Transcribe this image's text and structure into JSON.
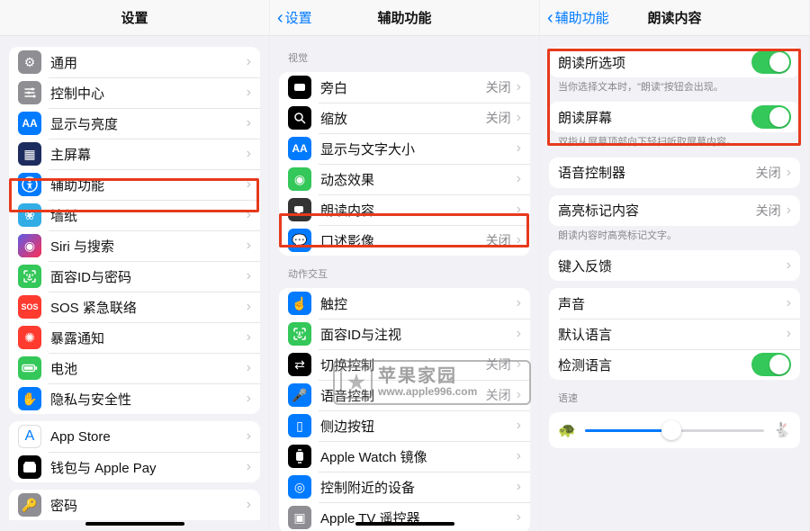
{
  "panel1": {
    "title": "设置",
    "groups": [
      {
        "rows": [
          {
            "icon": "gear",
            "bg": "bg-gray",
            "label": "通用"
          },
          {
            "icon": "sliders",
            "bg": "bg-gray",
            "label": "控制中心"
          },
          {
            "icon": "AA",
            "bg": "bg-blue",
            "label": "显示与亮度"
          },
          {
            "icon": "grid",
            "bg": "bg-darkblue",
            "label": "主屏幕"
          },
          {
            "icon": "access",
            "bg": "bg-blue",
            "label": "辅助功能"
          },
          {
            "icon": "flower",
            "bg": "bg-cyan",
            "label": "墙纸"
          },
          {
            "icon": "siri",
            "bg": "bg-black",
            "label": "Siri 与搜索"
          },
          {
            "icon": "faceid",
            "bg": "bg-green",
            "label": "面容ID与密码"
          },
          {
            "icon": "SOS",
            "bg": "bg-red",
            "label": "SOS 紧急联络"
          },
          {
            "icon": "virus",
            "bg": "bg-red",
            "label": "暴露通知"
          },
          {
            "icon": "battery",
            "bg": "bg-green",
            "label": "电池"
          },
          {
            "icon": "hand",
            "bg": "bg-blue",
            "label": "隐私与安全性"
          }
        ]
      },
      {
        "rows": [
          {
            "icon": "A",
            "bg": "bg-white",
            "label": "App Store"
          },
          {
            "icon": "wallet",
            "bg": "bg-black",
            "label": "钱包与 Apple Pay"
          }
        ]
      },
      {
        "rows": [
          {
            "icon": "key",
            "bg": "bg-gray",
            "label": "密码"
          }
        ]
      }
    ]
  },
  "panel2": {
    "back": "设置",
    "title": "辅助功能",
    "section1_header": "视觉",
    "section1_rows": [
      {
        "icon": "vo",
        "bg": "bg-black",
        "label": "旁白",
        "value": "关闭"
      },
      {
        "icon": "zoom",
        "bg": "bg-black",
        "label": "缩放",
        "value": "关闭"
      },
      {
        "icon": "AA",
        "bg": "bg-blue",
        "label": "显示与文字大小"
      },
      {
        "icon": "motion",
        "bg": "bg-green",
        "label": "动态效果"
      },
      {
        "icon": "speak",
        "bg": "bg-dark",
        "label": "朗读内容"
      },
      {
        "icon": "chat",
        "bg": "bg-blue",
        "label": "口述影像",
        "value": "关闭"
      }
    ],
    "section2_header": "动作交互",
    "section2_rows": [
      {
        "icon": "touch",
        "bg": "bg-blue",
        "label": "触控"
      },
      {
        "icon": "faceid",
        "bg": "bg-green",
        "label": "面容ID与注视"
      },
      {
        "icon": "switch",
        "bg": "bg-black",
        "label": "切换控制",
        "value": "关闭"
      },
      {
        "icon": "voice",
        "bg": "bg-blue",
        "label": "语音控制",
        "value": "关闭"
      },
      {
        "icon": "side",
        "bg": "bg-blue",
        "label": "侧边按钮"
      },
      {
        "icon": "watch",
        "bg": "bg-black",
        "label": "Apple Watch 镜像"
      },
      {
        "icon": "near",
        "bg": "bg-blue",
        "label": "控制附近的设备"
      },
      {
        "icon": "tv",
        "bg": "bg-gray",
        "label": "Apple TV 遥控器"
      }
    ]
  },
  "panel3": {
    "back": "辅助功能",
    "title": "朗读内容",
    "g1": {
      "rows": [
        {
          "label": "朗读所选项",
          "toggle": true
        }
      ],
      "footnote": "当你选择文本时，\"朗读\"按钮会出现。"
    },
    "g2": {
      "rows": [
        {
          "label": "朗读屏幕",
          "toggle": true
        }
      ],
      "footnote": "双指从屏幕顶部向下轻扫听取屏幕内容。"
    },
    "g3": {
      "rows": [
        {
          "label": "语音控制器",
          "value": "关闭"
        }
      ]
    },
    "g4": {
      "rows": [
        {
          "label": "高亮标记内容",
          "value": "关闭"
        }
      ],
      "footnote": "朗读内容时高亮标记文字。"
    },
    "g5": {
      "rows": [
        {
          "label": "键入反馈"
        }
      ]
    },
    "g6": {
      "rows": [
        {
          "label": "声音"
        },
        {
          "label": "默认语言"
        },
        {
          "label": "检测语言",
          "toggle": true
        }
      ]
    },
    "slider_header": "语速"
  },
  "watermark": {
    "title": "苹果家园",
    "url": "www.apple996.com"
  }
}
